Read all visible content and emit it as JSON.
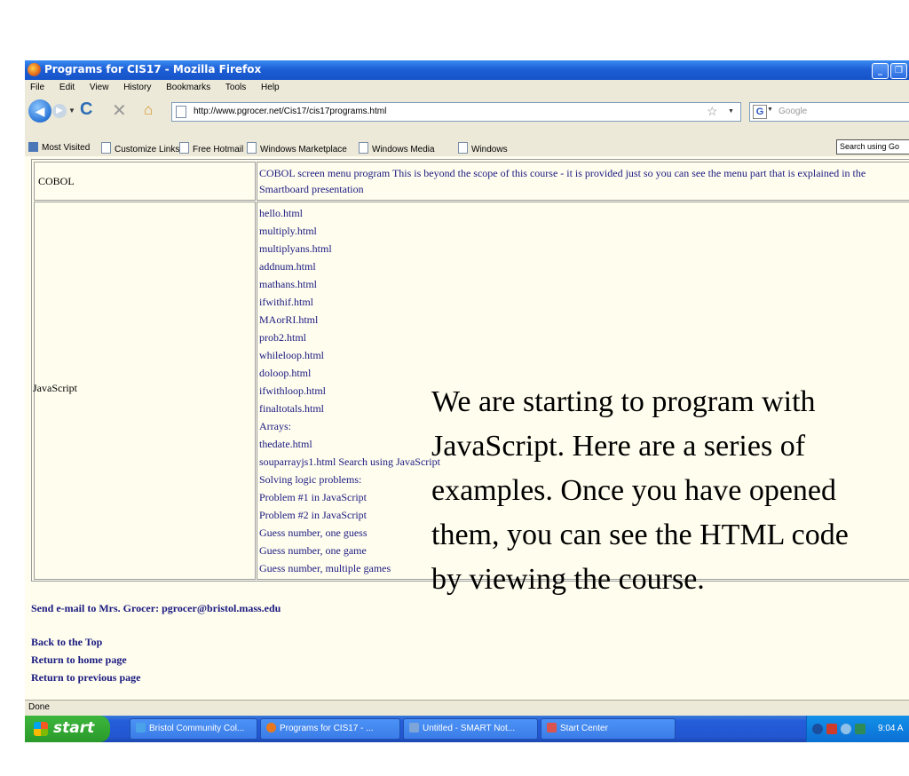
{
  "window": {
    "title": "Programs for CIS17 - Mozilla Firefox"
  },
  "menu": [
    "File",
    "Edit",
    "View",
    "History",
    "Bookmarks",
    "Tools",
    "Help"
  ],
  "nav": {
    "url": "http://www.pgrocer.net/Cis17/cis17programs.html",
    "search_placeholder": "Google"
  },
  "bookmarks": [
    "Most Visited",
    "Customize Links",
    "Free Hotmail",
    "Windows Marketplace",
    "Windows Media",
    "Windows"
  ],
  "bookmarks_search": "Search using Go",
  "table": {
    "row1": {
      "label": "COBOL",
      "desc": "COBOL screen menu program This is beyond the scope of this course - it is provided just so you can see the menu part that is explained in the Smartboard presentation"
    },
    "row2": {
      "label": "JavaScript",
      "files": [
        "hello.html",
        "multiply.html",
        "multiplyans.html",
        "addnum.html",
        "mathans.html",
        "ifwithif.html",
        "MAorRI.html",
        "prob2.html",
        "whileloop.html",
        "doloop.html",
        "ifwithloop.html",
        "finaltotals.html",
        "Arrays:",
        "thedate.html",
        "souparrayjs1.html Search using JavaScript",
        "Solving logic problems:",
        "Problem #1 in JavaScript",
        "Problem #2 in JavaScript",
        "Guess number, one guess",
        "Guess number, one game",
        "Guess number, multiple games"
      ]
    }
  },
  "overlay_text": "We are starting to program with JavaScript. Here are a series of examples. Once you have opened them, you can see the HTML code by viewing the course.",
  "footer": {
    "email": "Send e-mail to Mrs. Grocer: pgrocer@bristol.mass.edu",
    "top": "Back to the Top",
    "home": "Return to home page",
    "prev": "Return to previous page"
  },
  "status": "Done",
  "taskbar": {
    "start": "start",
    "tasks": [
      "Bristol Community Col...",
      "Programs for CIS17 - ...",
      "Untitled - SMART Not...",
      "Start Center"
    ],
    "clock": "9:04 A"
  }
}
